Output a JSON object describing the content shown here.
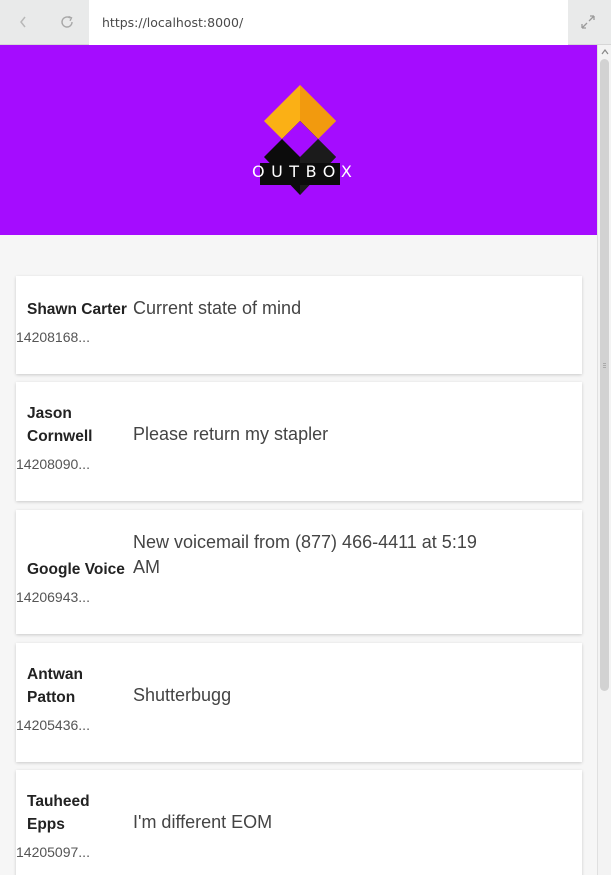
{
  "browser": {
    "url": "https://localhost:8000/",
    "back_icon": "back-icon",
    "reload_icon": "reload-icon",
    "expand_icon": "expand-icon"
  },
  "header": {
    "brand": "OUTBOX",
    "background": "#a50cff"
  },
  "messages": [
    {
      "sender": "Shawn Carter",
      "timestamp": "14208168...",
      "subject": "Current state of mind"
    },
    {
      "sender": "Jason Cornwell",
      "timestamp": "14208090...",
      "subject": "Please return my stapler"
    },
    {
      "sender": "Google Voice",
      "timestamp": "14206943...",
      "subject": "New voicemail from (877) 466-4411 at 5:19 AM"
    },
    {
      "sender": "Antwan Patton",
      "timestamp": "14205436...",
      "subject": "Shutterbugg"
    },
    {
      "sender": "Tauheed Epps",
      "timestamp": "14205097...",
      "subject": "I'm different EOM"
    }
  ]
}
